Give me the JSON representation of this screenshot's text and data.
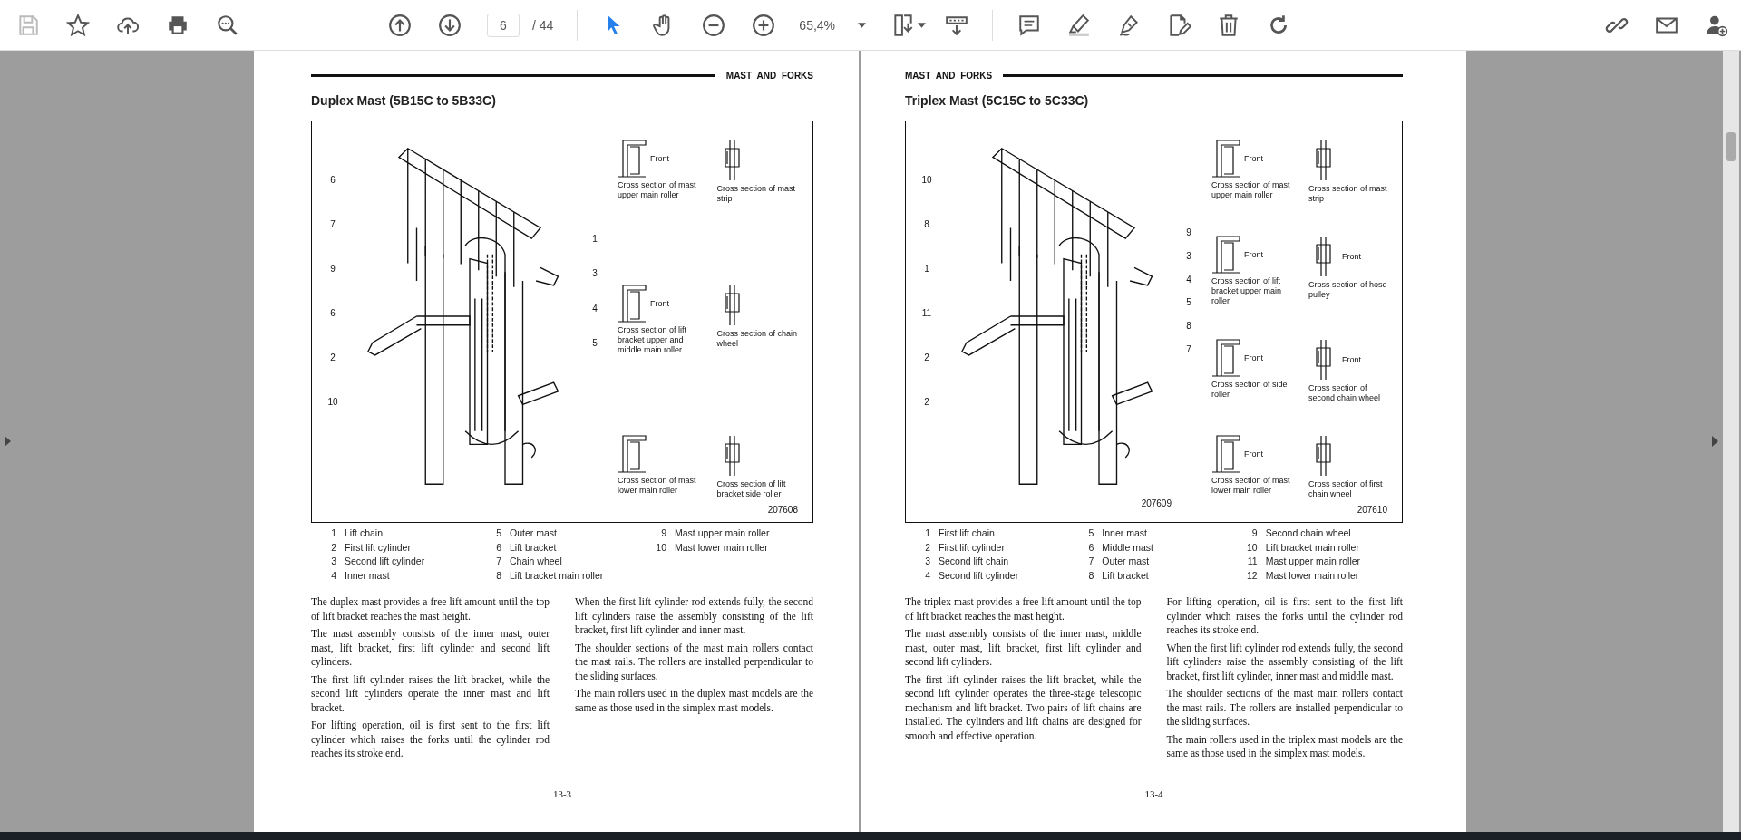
{
  "toolbar": {
    "file_tools": [
      {
        "kind": "save",
        "disabled": true
      },
      {
        "kind": "bookmark",
        "disabled": false
      },
      {
        "kind": "upload",
        "disabled": false
      },
      {
        "kind": "print",
        "disabled": false
      },
      {
        "kind": "find",
        "disabled": false
      }
    ],
    "page_nav": {
      "current": "6",
      "total": "/ 44"
    },
    "mode_tools": [
      {
        "kind": "select",
        "selected": true
      },
      {
        "kind": "hand",
        "selected": false
      }
    ],
    "zoom": {
      "value": "65,4%"
    },
    "edit_tools": [
      {
        "kind": "comment"
      },
      {
        "kind": "highlight"
      },
      {
        "kind": "sign"
      },
      {
        "kind": "edit"
      },
      {
        "kind": "delete"
      },
      {
        "kind": "rotate"
      }
    ],
    "share_tools": [
      {
        "kind": "link"
      },
      {
        "kind": "mail"
      },
      {
        "kind": "add-user"
      }
    ]
  },
  "pages": [
    {
      "section": "MAST AND FORKS",
      "title": "Duplex Mast (5B15C to 5B33C)",
      "figure": {
        "left_callouts": [
          "6",
          "7",
          "9",
          "6",
          "2",
          "10"
        ],
        "right_callouts": [
          "1",
          "3",
          "4",
          "5"
        ],
        "sections": [
          {
            "front": "Front",
            "caption": "Cross section of mast upper main roller"
          },
          {
            "caption": "Cross section of mast strip"
          },
          {
            "front": "Front",
            "caption": "Cross section of lift bracket upper and middle main roller"
          },
          {
            "caption": "Cross section of chain wheel"
          },
          {
            "caption": "Cross section of mast lower main roller"
          },
          {
            "caption": "Cross section of lift bracket side roller"
          }
        ],
        "sections_figure_number": "207608"
      },
      "legend": [
        [
          "1",
          "Lift chain"
        ],
        [
          "2",
          "First lift cylinder"
        ],
        [
          "3",
          "Second lift cylinder"
        ],
        [
          "4",
          "Inner mast"
        ],
        [
          "5",
          "Outer mast"
        ],
        [
          "6",
          "Lift bracket"
        ],
        [
          "7",
          "Chain wheel"
        ],
        [
          "8",
          "Lift bracket main roller"
        ],
        [
          "9",
          "Mast upper main roller"
        ],
        [
          "10",
          "Mast lower main roller"
        ]
      ],
      "paragraphs": [
        "The duplex mast provides a free lift amount until the top of lift bracket reaches the mast height.",
        "The mast assembly consists of the inner mast, outer mast, lift bracket, first lift cylinder and second lift cylinders.",
        "The first lift cylinder raises the lift bracket, while the second lift cylinders operate the inner mast and lift bracket.",
        "For lifting operation, oil is first sent to the first lift cylinder which raises the forks until the cylinder rod reaches its stroke end.",
        "When the first lift cylinder rod extends fully, the second lift cylinders raise the assembly consisting of the lift bracket, first lift cylinder and inner mast.",
        "The shoulder sections of the mast main rollers contact the mast rails.  The rollers are installed perpendicular to the sliding surfaces.",
        "The main rollers used in the duplex mast models are the same as those used in the simplex mast models."
      ],
      "page_number": "13-3"
    },
    {
      "section": "MAST AND FORKS",
      "title": "Triplex Mast (5C15C to 5C33C)",
      "figure": {
        "mast_figure_number": "207609",
        "left_callouts": [
          "10",
          "8",
          "1",
          "11",
          "2",
          "2"
        ],
        "right_callouts": [
          "9",
          "3",
          "4",
          "5",
          "8",
          "7"
        ],
        "sections": [
          {
            "front": "Front",
            "caption": "Cross section of mast upper main roller"
          },
          {
            "caption": "Cross section of mast strip"
          },
          {
            "front": "Front",
            "caption": "Cross section of lift bracket upper main roller"
          },
          {
            "front": "Front",
            "caption": "Cross section of hose pulley"
          },
          {
            "front": "Front",
            "caption": "Cross section of side roller"
          },
          {
            "front": "Front",
            "caption": "Cross section of second chain wheel"
          },
          {
            "front": "Front",
            "caption": "Cross section of mast lower main roller"
          },
          {
            "caption": "Cross section of first chain wheel"
          }
        ],
        "sections_figure_number": "207610"
      },
      "legend": [
        [
          "1",
          "First lift chain"
        ],
        [
          "2",
          "First lift cylinder"
        ],
        [
          "3",
          "Second lift chain"
        ],
        [
          "4",
          "Second lift cylinder"
        ],
        [
          "5",
          "Inner mast"
        ],
        [
          "6",
          "Middle mast"
        ],
        [
          "7",
          "Outer mast"
        ],
        [
          "8",
          "Lift bracket"
        ],
        [
          "9",
          "Second chain wheel"
        ],
        [
          "10",
          "Lift bracket main roller"
        ],
        [
          "11",
          "Mast upper main roller"
        ],
        [
          "12",
          "Mast lower main roller"
        ]
      ],
      "paragraphs": [
        "The triplex mast provides a free lift amount until the top of lift bracket reaches the mast height.",
        "The mast assembly consists of the inner mast, middle mast, outer mast, lift bracket, first lift cylinder and second lift cylinders.",
        "The first lift cylinder raises the lift bracket, while the second lift cylinder operates the three-stage telescopic mechanism and lift bracket.  Two pairs of lift chains are installed.  The cylinders and lift chains are designed for smooth and effective operation.",
        "For lifting operation, oil is first sent to the first lift cylinder which raises the forks until the cylinder rod reaches its stroke end.",
        "When the first lift cylinder rod extends fully, the second lift cylinders raise the assembly consisting of the lift bracket, first lift cylinder, inner mast and middle mast.",
        "The shoulder sections of the mast main rollers contact the mast rails.  The rollers are installed perpendicular to the sliding surfaces.",
        "The main rollers used in the triplex mast models are the same as those used in the simplex mast models."
      ],
      "page_number": "13-4"
    }
  ]
}
